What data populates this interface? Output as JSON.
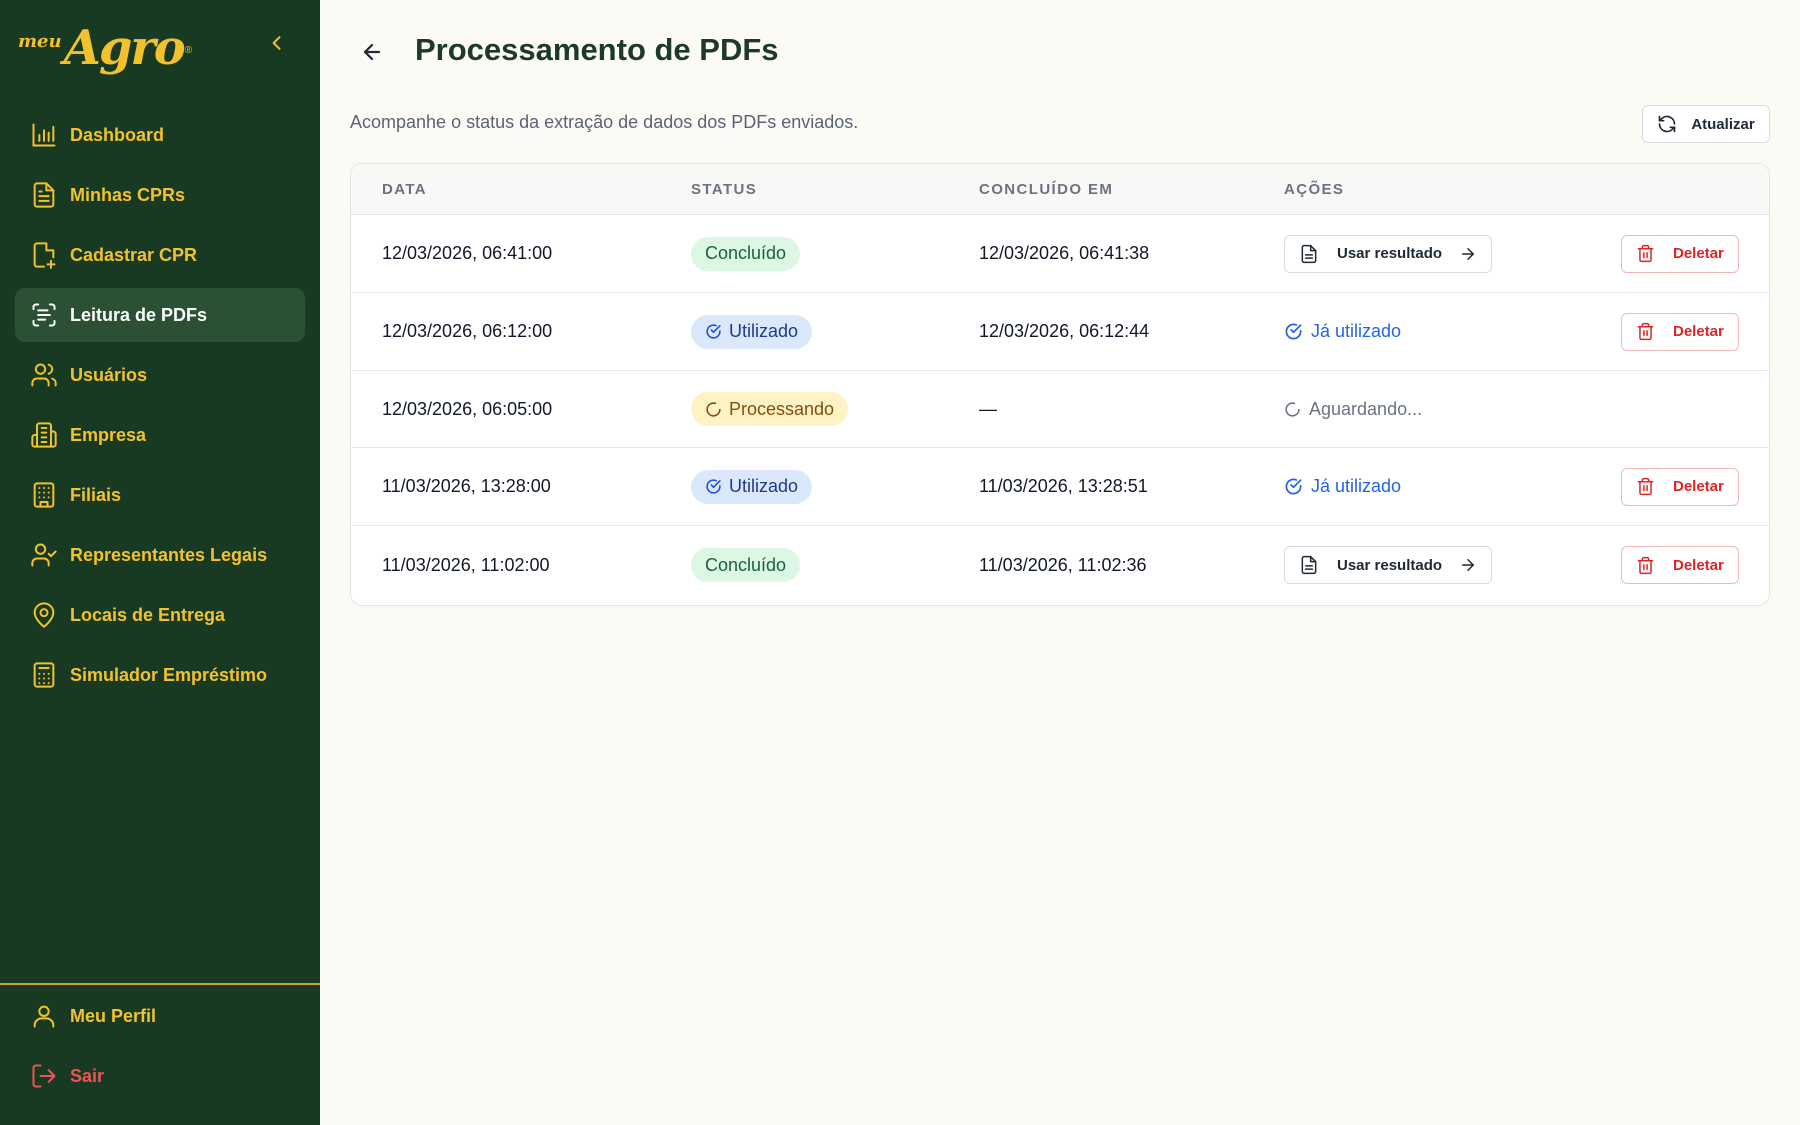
{
  "brand": {
    "small": "meu",
    "big": "Agro",
    "reg": "®"
  },
  "colors": {
    "sidebar_bg": "#193a22",
    "sidebar_active": "#2b5034",
    "accent_yellow": "#f2c12e",
    "logout_red": "#ef5454",
    "page_bg": "#fbfaf5"
  },
  "sidebar": {
    "items": [
      {
        "label": "Dashboard",
        "icon": "bar-chart-icon",
        "active": false
      },
      {
        "label": "Minhas CPRs",
        "icon": "document-icon",
        "active": false
      },
      {
        "label": "Cadastrar CPR",
        "icon": "file-plus-icon",
        "active": false
      },
      {
        "label": "Leitura de PDFs",
        "icon": "scan-text-icon",
        "active": true
      },
      {
        "label": "Usuários",
        "icon": "users-icon",
        "active": false
      },
      {
        "label": "Empresa",
        "icon": "building-icon",
        "active": false
      },
      {
        "label": "Filiais",
        "icon": "office-building-icon",
        "active": false
      },
      {
        "label": "Representantes Legais",
        "icon": "user-check-icon",
        "active": false
      },
      {
        "label": "Locais de Entrega",
        "icon": "map-pin-icon",
        "active": false
      },
      {
        "label": "Simulador Empréstimo",
        "icon": "calculator-icon",
        "active": false
      }
    ],
    "bottom": [
      {
        "label": "Meu Perfil",
        "icon": "user-icon"
      },
      {
        "label": "Sair",
        "icon": "logout-icon"
      }
    ]
  },
  "header": {
    "title": "Processamento de PDFs",
    "subtitle": "Acompanhe o status da extração de dados dos PDFs enviados.",
    "refresh_label": "Atualizar"
  },
  "table": {
    "columns": [
      "DATA",
      "STATUS",
      "CONCLUÍDO EM",
      "AÇÕES"
    ],
    "use_result_label": "Usar resultado",
    "already_used_label": "Já utilizado",
    "waiting_label": "Aguardando...",
    "delete_label": "Deletar",
    "rows": [
      {
        "date": "12/03/2026, 06:41:00",
        "status": "Concluído",
        "completed": "12/03/2026, 06:41:38"
      },
      {
        "date": "12/03/2026, 06:12:00",
        "status": "Utilizado",
        "completed": "12/03/2026, 06:12:44"
      },
      {
        "date": "12/03/2026, 06:05:00",
        "status": "Processando",
        "completed": "—"
      },
      {
        "date": "11/03/2026, 13:28:00",
        "status": "Utilizado",
        "completed": "11/03/2026, 13:28:51"
      },
      {
        "date": "11/03/2026, 11:02:00",
        "status": "Concluído",
        "completed": "11/03/2026, 11:02:36"
      }
    ]
  }
}
